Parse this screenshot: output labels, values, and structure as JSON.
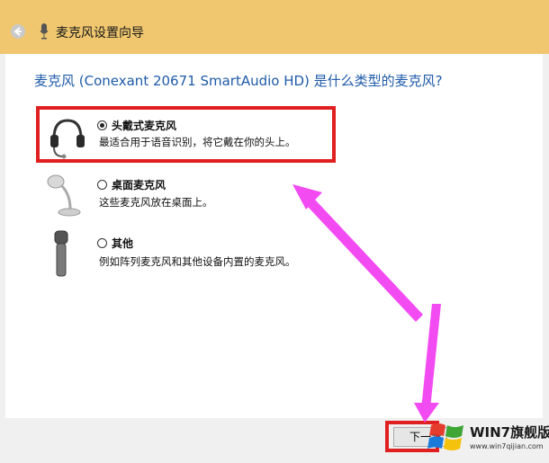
{
  "window": {
    "title": "麦克风设置向导"
  },
  "wizard": {
    "question": "麦克风 (Conexant 20671 SmartAudio HD) 是什么类型的麦克风?",
    "options": [
      {
        "label": "头戴式麦克风",
        "desc": "最适合用于语音识别，将它戴在你的头上。",
        "selected": true,
        "icon": "headset-icon"
      },
      {
        "label": "桌面麦克风",
        "desc": "这些麦克风放在桌面上。",
        "selected": false,
        "icon": "desktop-microphone-icon"
      },
      {
        "label": "其他",
        "desc": "例如阵列麦克风和其他设备内置的麦克风。",
        "selected": false,
        "icon": "handheld-microphone-icon"
      }
    ]
  },
  "footer": {
    "next_label": "下一步"
  },
  "watermark": {
    "title": "WIN7旗舰版",
    "url": "www.win7qijian.com"
  },
  "colors": {
    "accent": "#f0c76e",
    "highlight": "#e02020",
    "arrow": "#f24bf2",
    "link": "#1e5aa8"
  }
}
